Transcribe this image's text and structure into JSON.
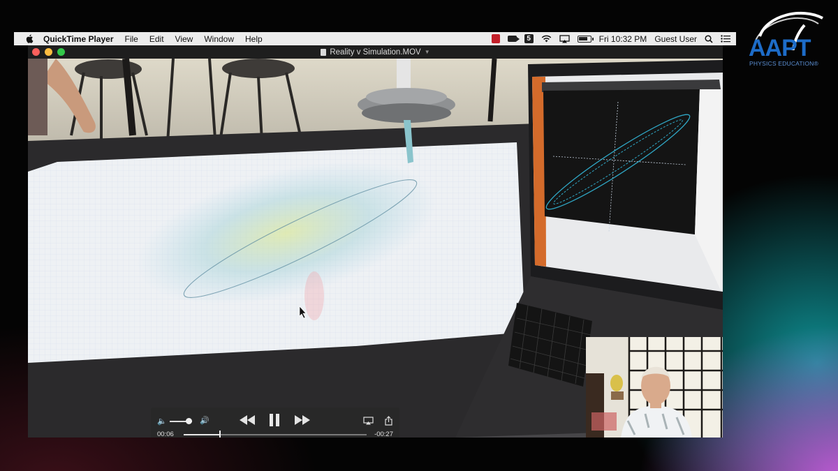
{
  "menubar": {
    "app_name": "QuickTime Player",
    "items": [
      "File",
      "Edit",
      "View",
      "Window",
      "Help"
    ],
    "clock": "Fri 10:32 PM",
    "user": "Guest User",
    "icons": [
      "screen-record-icon",
      "camera-icon",
      "s-app-icon",
      "wifi-icon",
      "airplay-icon",
      "battery-icon",
      "search-icon",
      "list-icon"
    ]
  },
  "window": {
    "title": "Reality v Simulation.MOV"
  },
  "controls": {
    "elapsed": "00:06",
    "remaining": "-00:27",
    "progress": 0.2,
    "volume": 0.85
  },
  "logo": {
    "name": "AAPT",
    "tagline": "PHYSICS EDUCATION®"
  },
  "colors": {
    "menubar_bg": "#ececec",
    "controls_bg": "#282828",
    "logo_blue": "#1d6cc8",
    "plot_line": "#2fa6c4"
  }
}
